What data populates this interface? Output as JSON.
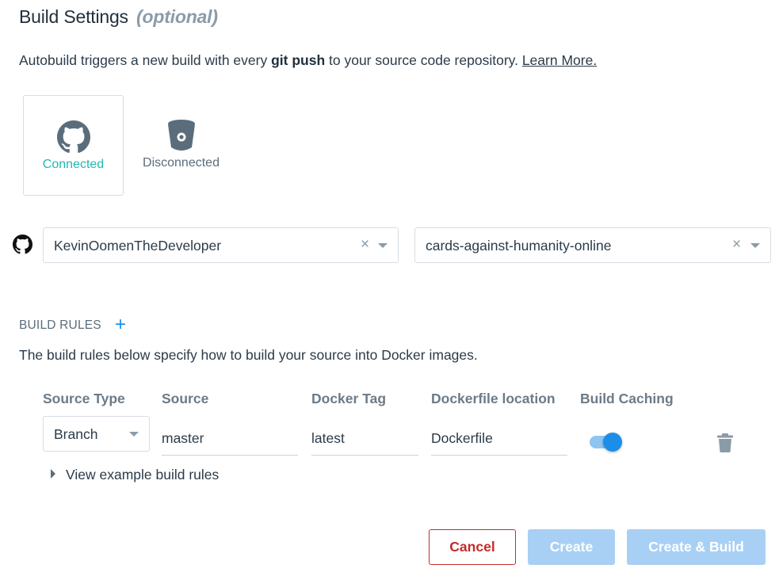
{
  "header": {
    "title": "Build Settings",
    "optional": "(optional)"
  },
  "intro": {
    "text_before": "Autobuild triggers a new build with every ",
    "bold": "git push",
    "text_after": " to your source code repository. ",
    "link": "Learn More."
  },
  "providers": [
    {
      "name": "GitHub",
      "icon": "github-icon",
      "status": "Connected",
      "color": "#22b8b0"
    },
    {
      "name": "Bitbucket",
      "icon": "bitbucket-icon",
      "status": "Disconnected",
      "color": "#5b6d7b"
    }
  ],
  "source": {
    "account": "KevinOomenTheDeveloper",
    "repository": "cards-against-humanity-online",
    "clear_glyph": "×"
  },
  "build_rules": {
    "heading": "BUILD RULES",
    "add_glyph": "+",
    "description": "The build rules below specify how to build your source into Docker images.",
    "columns": [
      "Source Type",
      "Source",
      "Docker Tag",
      "Dockerfile location",
      "Build Caching"
    ],
    "rule": {
      "source_type": "Branch",
      "source": "master",
      "docker_tag": "latest",
      "dockerfile_location": "Dockerfile",
      "build_caching": true
    },
    "example_link": "View example build rules"
  },
  "actions": {
    "cancel": "Cancel",
    "create": "Create",
    "create_build": "Create & Build"
  },
  "colors": {
    "accent": "#1d8ee8",
    "connected": "#22b8b0",
    "danger": "#c62b2b",
    "disabled_button": "#a8d0f5"
  }
}
